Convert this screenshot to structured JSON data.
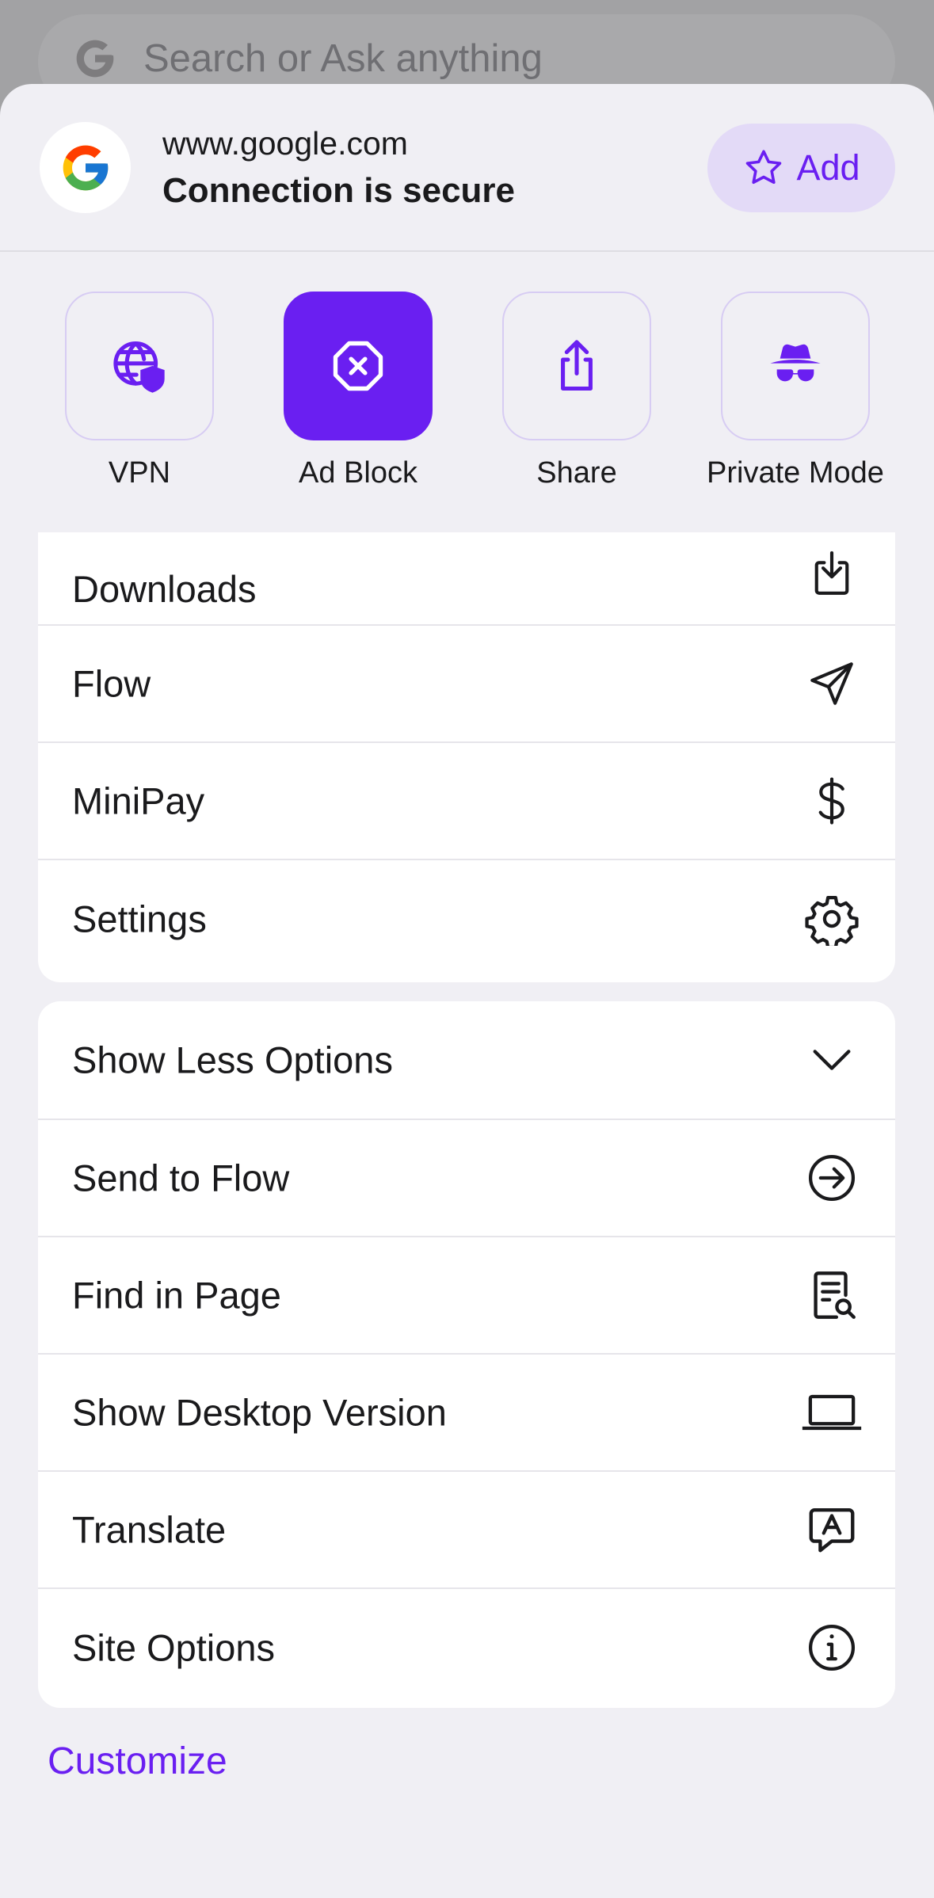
{
  "search": {
    "placeholder": "Search or Ask anything"
  },
  "site": {
    "url": "www.google.com",
    "status": "Connection is secure",
    "add_label": "Add"
  },
  "quick_actions": [
    {
      "label": "VPN",
      "icon": "globe-shield-icon",
      "active": false
    },
    {
      "label": "Ad Block",
      "icon": "ad-block-icon",
      "active": true
    },
    {
      "label": "Share",
      "icon": "share-icon",
      "active": false
    },
    {
      "label": "Private Mode",
      "icon": "incognito-icon",
      "active": false
    }
  ],
  "menu_primary": [
    {
      "label": "Downloads",
      "icon": "download-icon"
    },
    {
      "label": "Flow",
      "icon": "send-icon"
    },
    {
      "label": "MiniPay",
      "icon": "dollar-icon"
    },
    {
      "label": "Settings",
      "icon": "gear-icon"
    }
  ],
  "menu_more": [
    {
      "label": "Show Less Options",
      "icon": "chevron-down-icon"
    },
    {
      "label": "Send to Flow",
      "icon": "arrow-circle-icon"
    },
    {
      "label": "Find in Page",
      "icon": "find-document-icon"
    },
    {
      "label": "Show Desktop Version",
      "icon": "laptop-icon"
    },
    {
      "label": "Translate",
      "icon": "translate-icon"
    },
    {
      "label": "Site Options",
      "icon": "info-icon"
    }
  ],
  "customize_label": "Customize",
  "colors": {
    "accent": "#6a1ff1",
    "accent_soft": "#e3daf7",
    "sheet_bg": "#f0eff4"
  }
}
